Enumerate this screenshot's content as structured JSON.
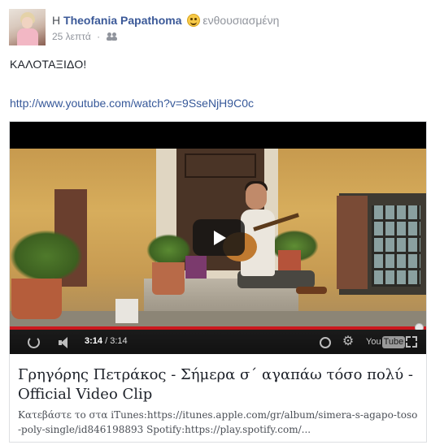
{
  "post": {
    "author_prefix": "Η",
    "author_name": "Theofania Papathoma",
    "feeling_icon": "happy-emoji-icon",
    "feeling_text": "ενθουσιασμένη",
    "timestamp": "25 λεπτά",
    "separator": "·",
    "audience_icon": "friends-icon",
    "text": "ΚΑΛΟΤΑΞΙΔΟ!",
    "link_url": "http://www.youtube.com/watch?v=9SseNjH9C0c"
  },
  "video": {
    "progress": 1.0,
    "time_current": "3:14",
    "time_sep": " / ",
    "time_total": "3:14",
    "logo_you": "You",
    "logo_tube": "Tube",
    "colors": {
      "progress": "#cc181e",
      "controls_bg": "#1b1b1b"
    }
  },
  "attachment": {
    "title": "Γρηγόρης Πετράκος - Σήμερα σ΄ αγαπάω τόσο πολύ - Official Video Clip",
    "description": "Κατεβάστε το στα iTunes:https://itunes.apple.com/gr/album/simera-s-agapo-toso-poly-single/id846198893 Spotify:https://play.spotify.com/..."
  },
  "colors": {
    "author_link": "#3b5998",
    "url_link": "#365899",
    "muted": "#90949c"
  }
}
